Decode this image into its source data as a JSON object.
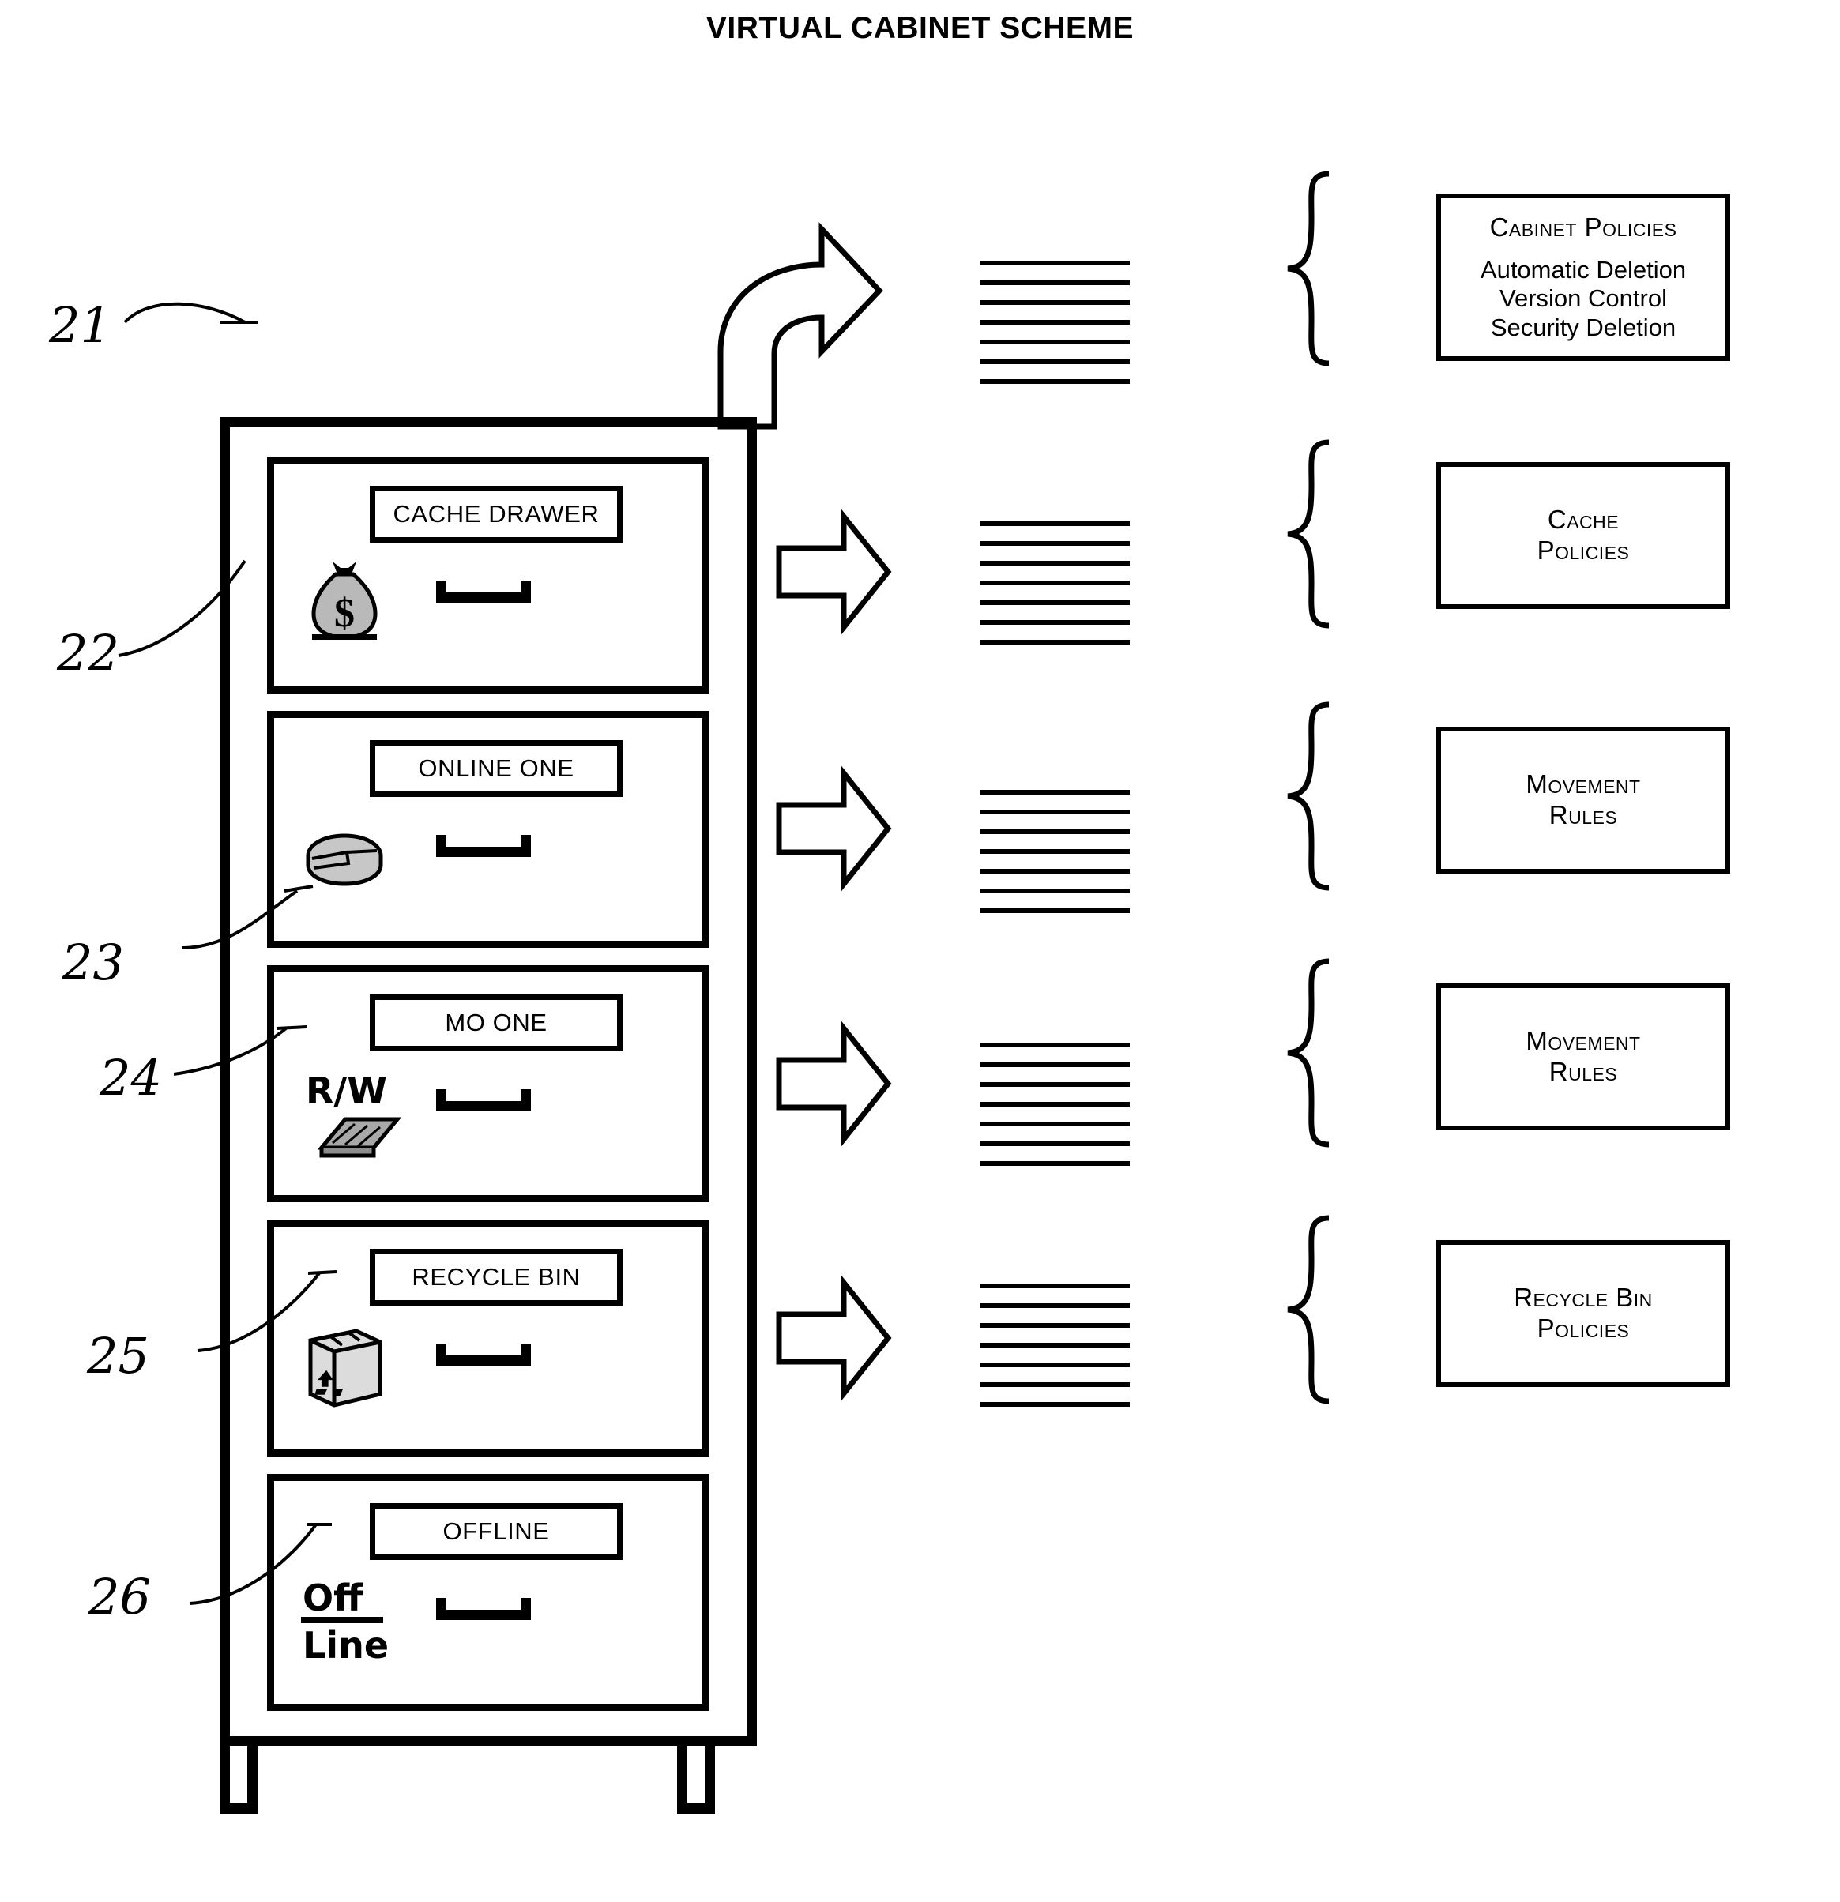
{
  "figure": {
    "title": "VIRTUAL CABINET SCHEME"
  },
  "cabinet": {
    "reference_numeral": "21",
    "drawers": [
      {
        "label": "CACHE DRAWER",
        "reference_numeral": "22",
        "icon": "money-bag-icon"
      },
      {
        "label": "ONLINE ONE",
        "reference_numeral": "23",
        "icon": "disk-platter-icon"
      },
      {
        "label": "MO ONE",
        "reference_numeral": "24",
        "icon": "rw-optical-disc-icon",
        "icon_text": "R/W"
      },
      {
        "label": "RECYCLE BIN",
        "reference_numeral": "25",
        "icon": "recycle-bin-icon"
      },
      {
        "label": "OFFLINE",
        "reference_numeral": "26",
        "icon": "off-line-icon",
        "icon_text_top": "Off",
        "icon_text_bottom": "Line"
      }
    ]
  },
  "policies": [
    {
      "title": "Cabinet Policies",
      "details": "Automatic Deletion\nVersion Control\nSecurity Deletion",
      "line_count": 7
    },
    {
      "title": "Cache\nPolicies",
      "details": "",
      "line_count": 7
    },
    {
      "title": "Movement\nRules",
      "details": "",
      "line_count": 7
    },
    {
      "title": "Movement\nRules",
      "details": "",
      "line_count": 7
    },
    {
      "title": "Recycle Bin\nPolicies",
      "details": "",
      "line_count": 7
    }
  ],
  "arrows": {
    "cabinet_arrow": "curved-block-arrow-right",
    "drawer_arrows": [
      "block-arrow-right",
      "block-arrow-right",
      "block-arrow-right",
      "block-arrow-right"
    ]
  },
  "colors": {
    "ink": "#000000",
    "paper": "#ffffff"
  }
}
